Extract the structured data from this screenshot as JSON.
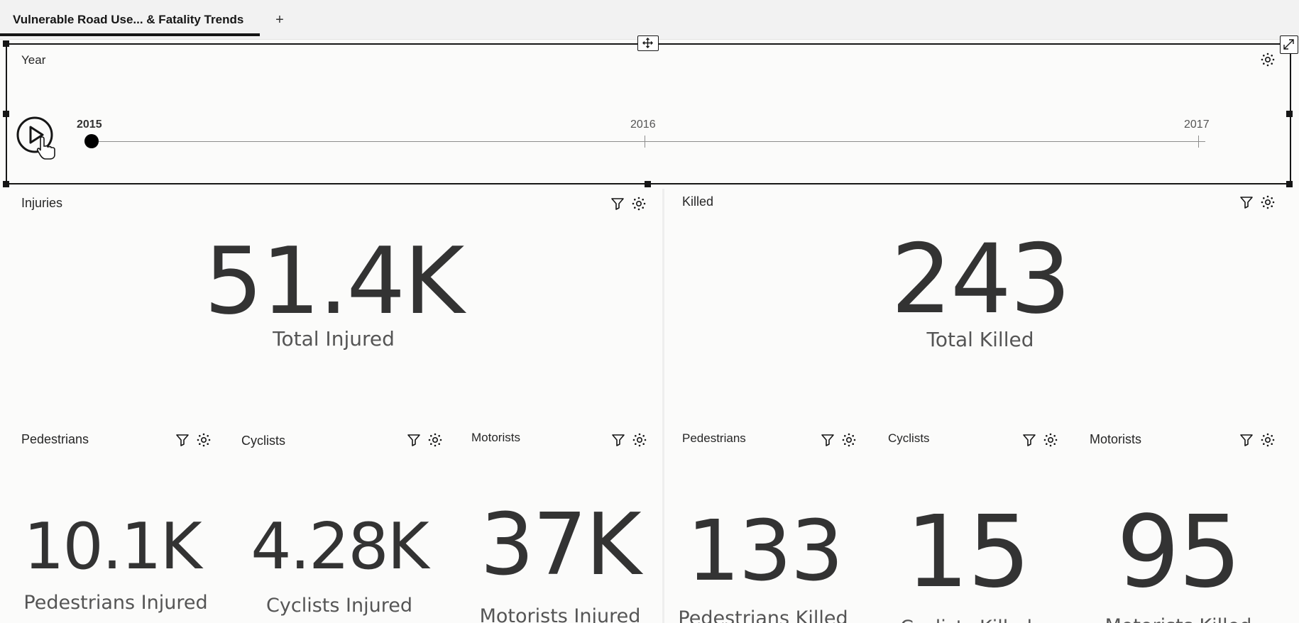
{
  "tabs": {
    "active_label": "Vulnerable Road Use... & Fatality Trends",
    "add_label": "+"
  },
  "timeline": {
    "title": "Year",
    "years": [
      "2015",
      "2016",
      "2017"
    ],
    "current_year": "2015"
  },
  "injuries": {
    "title": "Injuries",
    "total_value": "51.4K",
    "total_caption": "Total Injured",
    "pedestrians": {
      "title": "Pedestrians",
      "value": "10.1K",
      "caption": "Pedestrians Injured"
    },
    "cyclists": {
      "title": "Cyclists",
      "value": "4.28K",
      "caption": "Cyclists Injured"
    },
    "motorists": {
      "title": "Motorists",
      "value": "37K",
      "caption": "Motorists Injured"
    }
  },
  "killed": {
    "title": "Killed",
    "total_value": "243",
    "total_caption": "Total Killed",
    "pedestrians": {
      "title": "Pedestrians",
      "value": "133",
      "caption": "Pedestrians Killed"
    },
    "cyclists": {
      "title": "Cyclists",
      "value": "15",
      "caption": "Cyclists Killed"
    },
    "motorists": {
      "title": "Motorists",
      "value": "95",
      "caption": "Motorists Killed"
    }
  },
  "icons": {
    "filter": "filter-icon",
    "settings": "settings-icon",
    "move": "move-icon",
    "expand": "expand-icon",
    "play": "play-icon"
  }
}
